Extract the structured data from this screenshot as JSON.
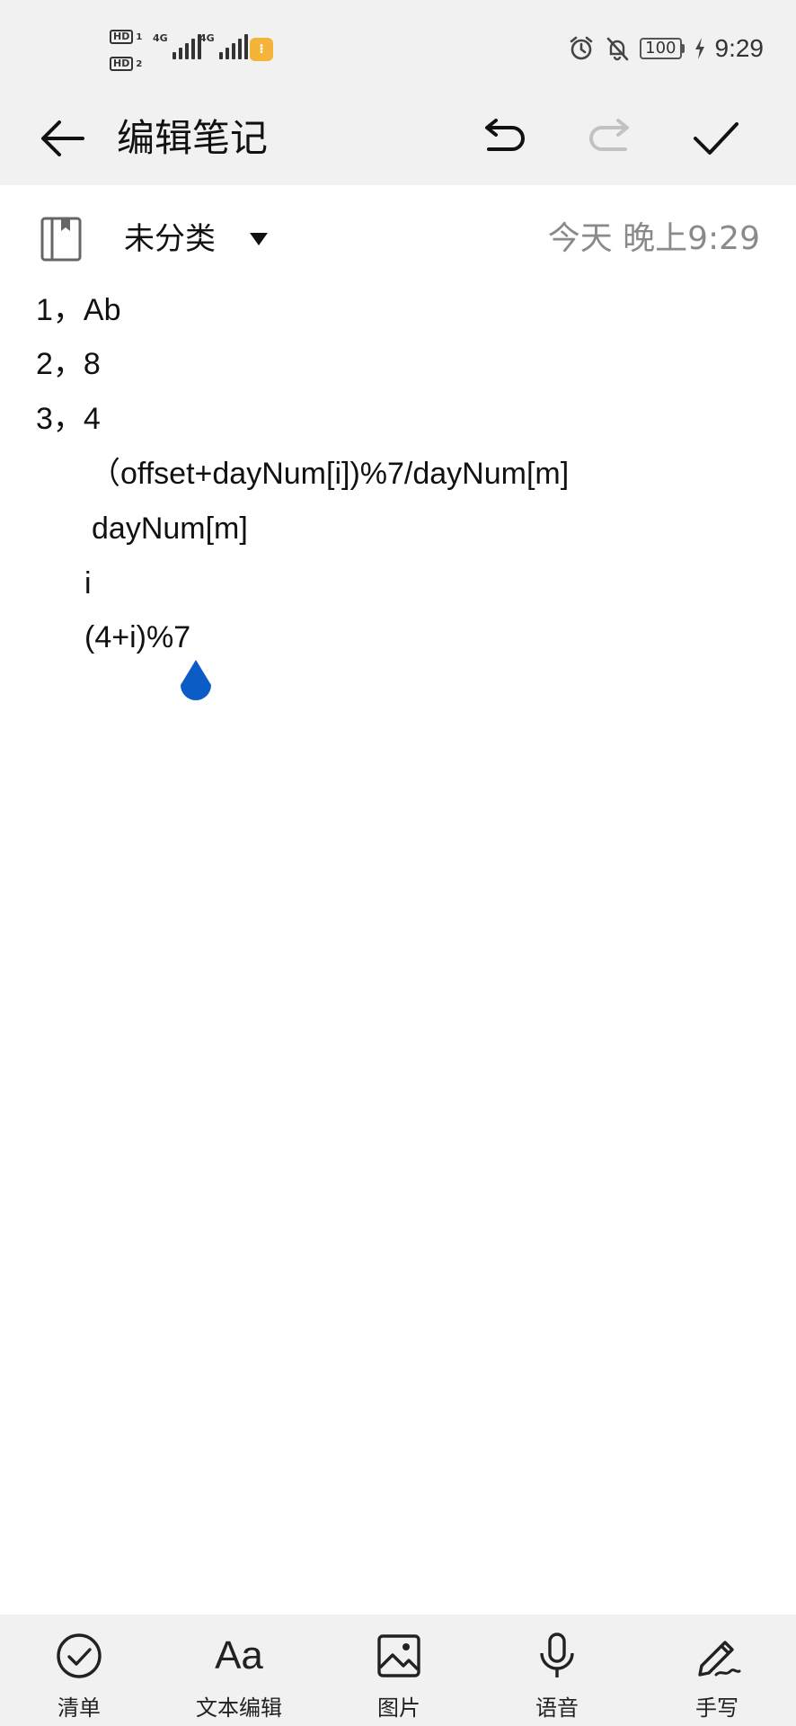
{
  "status_bar": {
    "hd1": "HD",
    "hd1_sub": "1",
    "hd2": "HD",
    "hd2_sub": "2",
    "net1": "4G",
    "net2": "4G",
    "battery": "100",
    "time": "9:29"
  },
  "toolbar": {
    "title": "编辑笔记"
  },
  "note": {
    "category": "未分类",
    "timestamp": "今天 晚上9:29",
    "lines": [
      "1，Ab",
      "2，8",
      "3，4",
      "（offset+dayNum[i])%7/dayNum[m]",
      "dayNum[m]",
      "i",
      "(4+i)%7"
    ]
  },
  "bottom_bar": {
    "checklist": "清单",
    "text_edit_icon": "Aa",
    "text_edit": "文本编辑",
    "image": "图片",
    "voice": "语音",
    "handwriting": "手写"
  },
  "colors": {
    "accent": "#0b5cc5",
    "background_bar": "#f1f1f1",
    "muted_text": "#8a8a8a"
  }
}
